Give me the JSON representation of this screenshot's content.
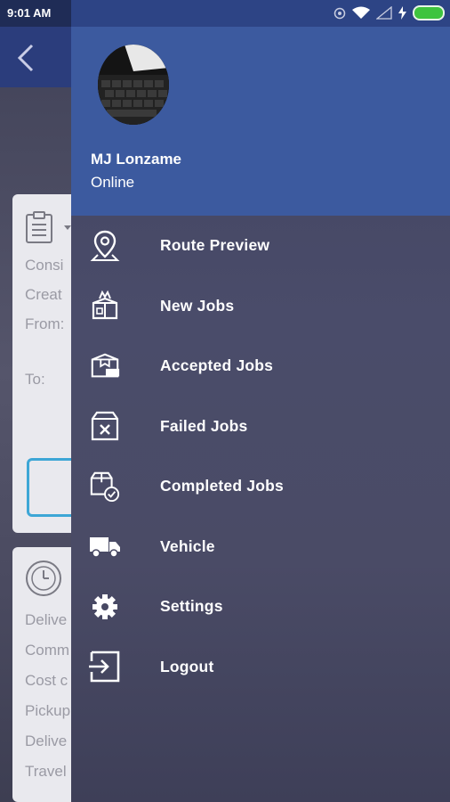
{
  "status_bar": {
    "time": "9:01 AM"
  },
  "background_screen": {
    "card1_lines": [
      "Consi",
      "Creat",
      "From:",
      "To:"
    ],
    "card2_lines": [
      "Delive",
      "Comm",
      "Cost c",
      "Pickup",
      "Delive",
      "Travel"
    ]
  },
  "drawer": {
    "user": {
      "name": "MJ Lonzame",
      "status": "Online"
    },
    "menu": [
      {
        "label": "Route Preview",
        "icon": "map-pin-icon"
      },
      {
        "label": "New Jobs",
        "icon": "new-box-icon"
      },
      {
        "label": "Accepted Jobs",
        "icon": "accepted-box-icon"
      },
      {
        "label": "Failed Jobs",
        "icon": "failed-box-icon"
      },
      {
        "label": "Completed Jobs",
        "icon": "completed-box-icon"
      },
      {
        "label": "Vehicle",
        "icon": "truck-icon"
      },
      {
        "label": "Settings",
        "icon": "gear-icon"
      },
      {
        "label": "Logout",
        "icon": "logout-icon"
      }
    ]
  },
  "colors": {
    "header_blue": "#3c5a9f",
    "status_blue": "#2d4485",
    "battery_green": "#3ec43e",
    "accent_cyan": "#3da6d6"
  }
}
